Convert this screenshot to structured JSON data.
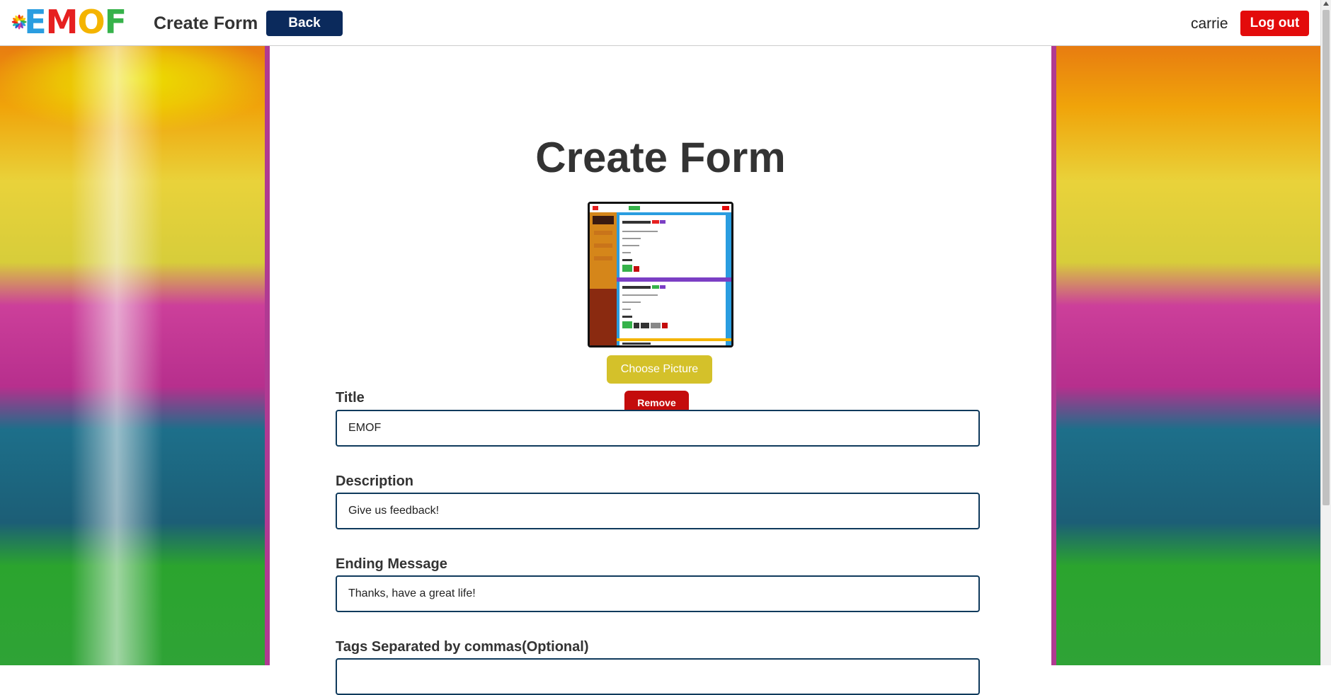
{
  "header": {
    "logo_text": "EMOF",
    "title": "Create Form",
    "back_label": "Back",
    "username": "carrie",
    "logout_label": "Log out"
  },
  "main": {
    "page_title": "Create Form",
    "choose_picture_label": "Choose Picture",
    "remove_label": "Remove",
    "fields": {
      "title_label": "Title",
      "title_value": "EMOF",
      "description_label": "Description",
      "description_value": "Give us feedback!",
      "ending_label": "Ending Message",
      "ending_value": "Thanks, have a great life!",
      "tags_label": "Tags Separated by commas(Optional)",
      "tags_value": ""
    }
  },
  "colors": {
    "back_button": "#0b2a5c",
    "logout_button": "#e30b0b",
    "choose_button": "#d4c12a",
    "remove_button": "#c40c0c",
    "panel_border": "#b03a92",
    "input_border": "#0f3a5c"
  }
}
